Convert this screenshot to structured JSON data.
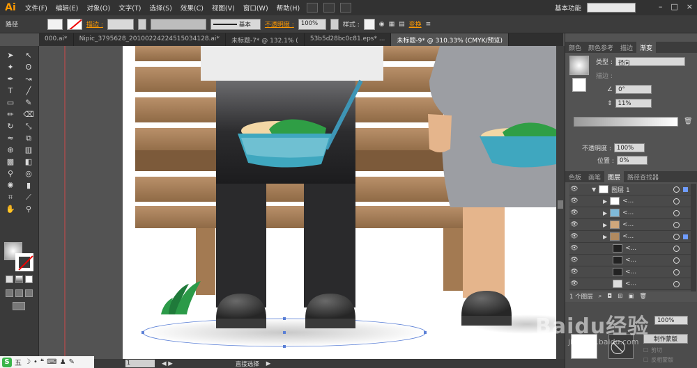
{
  "app": {
    "logo": "Ai"
  },
  "menu": [
    "文件(F)",
    "编辑(E)",
    "对象(O)",
    "文字(T)",
    "选择(S)",
    "效果(C)",
    "视图(V)",
    "窗口(W)",
    "帮助(H)"
  ],
  "workspace": "基本功能",
  "controlbar": {
    "object_type": "路径",
    "stroke_label": "描边 :",
    "stroke_style": "基本",
    "opacity_label": "不透明度 :",
    "opacity_value": "100%",
    "style_label": "样式 :",
    "transform_label": "变换"
  },
  "tabs": [
    "000.ai*",
    "Nipic_3795628_20100224224515034128.ai*",
    "未标题-7* @ 132.1% (",
    "53b5d28bc0c81.eps* ...",
    "未标题-9* @ 310.33% (CMYK/预览)"
  ],
  "gradient_panel": {
    "tabs": [
      "颜色",
      "颜色参考",
      "描边",
      "渐变"
    ],
    "type_label": "类型 :",
    "type_value": "径向",
    "stroke_label": "描边 :",
    "angle_value": "0°",
    "ratio_value": "11%",
    "opacity_label": "不透明度 :",
    "opacity_value": "100%",
    "location_label": "位置 :",
    "location_value": "0%"
  },
  "layers_panel": {
    "tabs": [
      "色板",
      "画笔",
      "图层",
      "路径查找器"
    ],
    "layer_name": "图层 1",
    "sublayer_label": "<...",
    "footer": "1 个图层"
  },
  "transparency_panel": {
    "opacity_value": "100%",
    "make_mask_label": "制作蒙版",
    "clip_label": "剪切",
    "invert_label": "反相蒙版"
  },
  "statusbar": {
    "zoom": "310.33%",
    "page": "1",
    "tool_label": "直接选择"
  },
  "ime": {
    "label": "五"
  },
  "watermark": {
    "brand": "Baidu经验",
    "url": "jingyan.baidu.com"
  },
  "colors": {
    "bench_wood": "#a2784f",
    "pants": "#2c2c2e",
    "bowl": "#3fa7bf",
    "skin": "#e5b58c",
    "coat": "#9c9ea3"
  }
}
